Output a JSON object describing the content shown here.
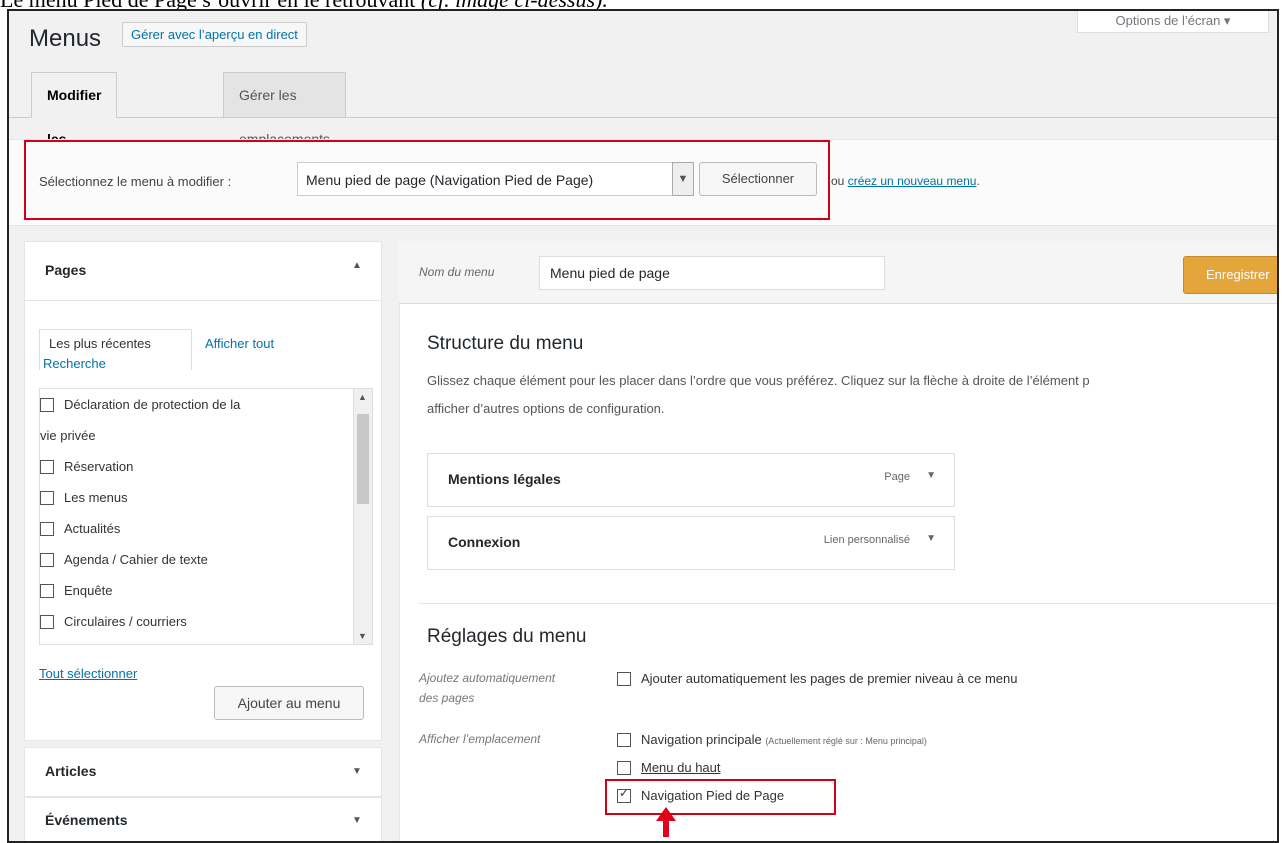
{
  "caption": {
    "text": "Le menu Pied de Page s’ouvrir en le retrouvant",
    "italic": "(cf. image ci-dessus)."
  },
  "screen_options_label": "Options de l’écran",
  "header": {
    "title": "Menus",
    "live_preview_button": "Gérer avec l’aperçu en direct"
  },
  "tabs": {
    "edit": "Modifier les menus",
    "locations": "Gérer les emplacements"
  },
  "select_menu": {
    "label": "Sélectionnez le menu à modifier :",
    "selected": "Menu pied de page (Navigation Pied de Page)",
    "select_button": "Sélectionner",
    "or_text": "ou",
    "create_link": "créez un nouveau menu",
    "period": "."
  },
  "pages_panel": {
    "title": "Pages",
    "tab_recent": "Les plus récentes",
    "tab_all": "Afficher tout",
    "tab_search": "Recherche",
    "items": [
      "Déclaration de protection de la",
      "vie privée",
      "Réservation",
      "Les menus",
      "Actualités",
      "Agenda / Cahier de texte",
      "Enquête",
      "Circulaires / courriers"
    ],
    "select_all": "Tout sélectionner",
    "add_button": "Ajouter au menu"
  },
  "articles_panel": {
    "title": "Articles"
  },
  "events_panel": {
    "title": "Événements"
  },
  "menu_editor": {
    "name_label": "Nom du menu",
    "name_value": "Menu pied de page",
    "save_button": "Enregistrer",
    "structure_title": "Structure du menu",
    "structure_desc_1": "Glissez chaque élément pour les placer dans l’ordre que vous préférez. Cliquez sur la flèche à droite de l’élément p",
    "structure_desc_2": "afficher d’autres options de configuration.",
    "items": [
      {
        "name": "Mentions légales",
        "type": "Page"
      },
      {
        "name": "Connexion",
        "type": "Lien personnalisé"
      }
    ],
    "settings_title": "Réglages du menu",
    "auto_add_label_1": "Ajoutez automatiquement",
    "auto_add_label_2": "des pages",
    "auto_add_option": "Ajouter automatiquement les pages de premier niveau à ce menu",
    "location_label": "Afficher l’emplacement",
    "locations": {
      "primary": "Navigation principale",
      "primary_note": "(Actuellement réglé sur : Menu principal)",
      "top": "Menu du haut",
      "footer": "Navigation Pied de Page"
    }
  },
  "highlight_color": "#d0021b"
}
